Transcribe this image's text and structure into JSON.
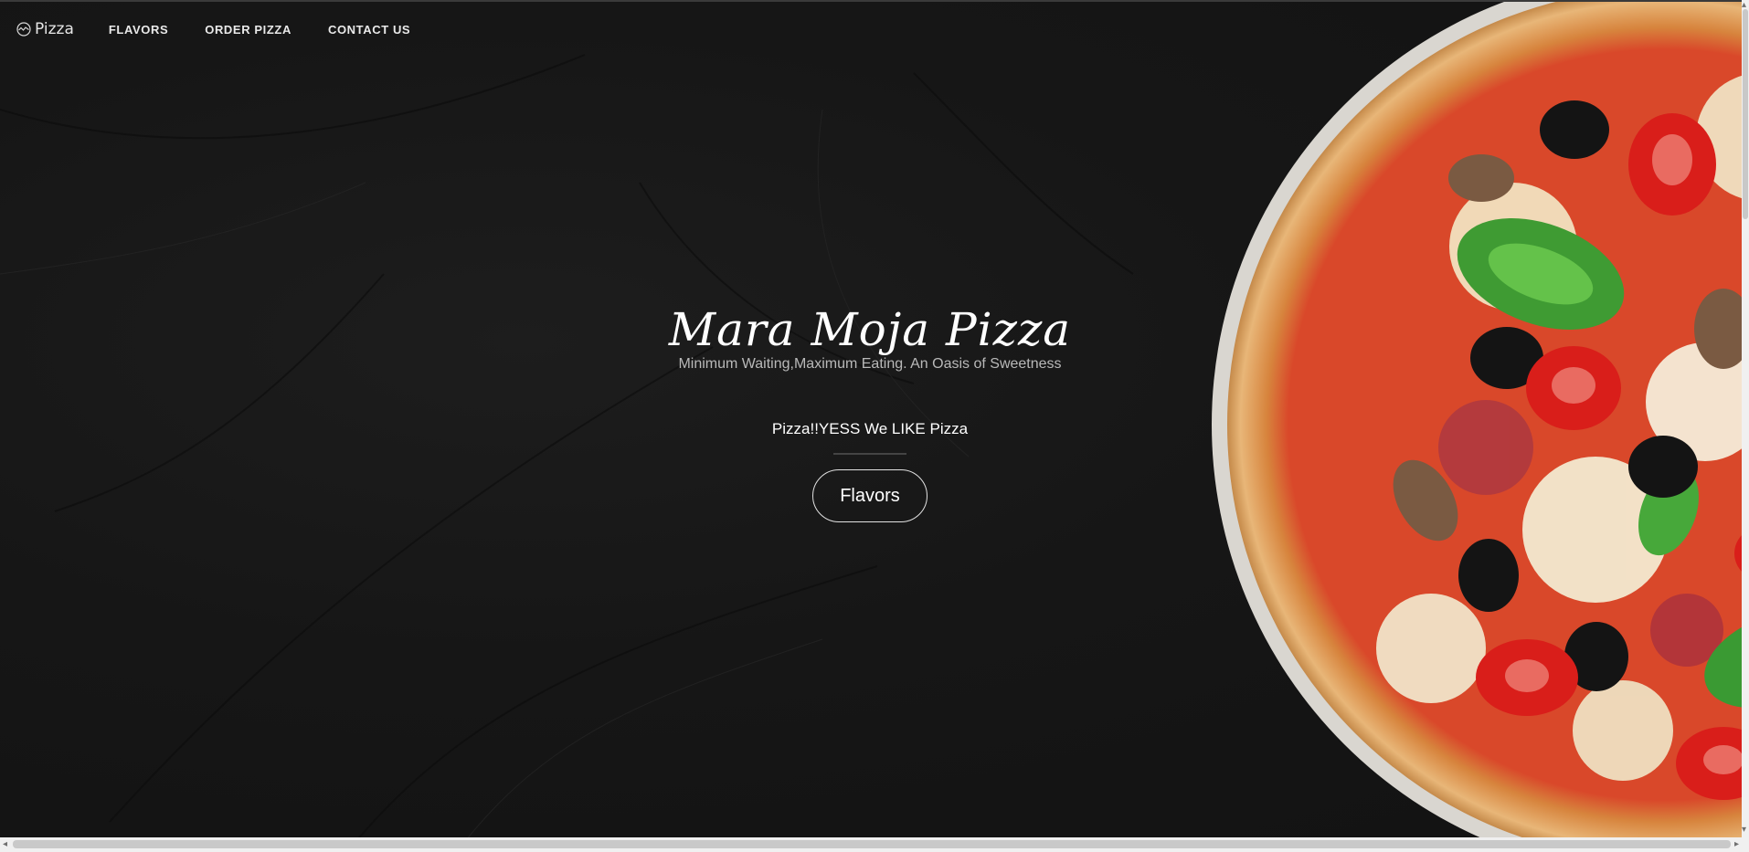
{
  "nav": {
    "brand": "Pizza",
    "links": [
      "FLAVORS",
      "ORDER PIZZA",
      "CONTACT US"
    ]
  },
  "hero": {
    "title": "Mara Moja Pizza",
    "subtitle": "Minimum Waiting,Maximum Eating. An Oasis of Sweetness",
    "tagline": "Pizza!!YESS We LIKE Pizza",
    "button": "Flavors"
  },
  "colors": {
    "background": "#151515",
    "text": "#ffffff",
    "subtext": "#b9b9b9"
  },
  "icons": {
    "brand": "pizza-logo-icon",
    "scroll_up": "chevron-up-icon",
    "scroll_down": "chevron-down-icon",
    "scroll_left": "chevron-left-icon",
    "scroll_right": "chevron-right-icon"
  }
}
